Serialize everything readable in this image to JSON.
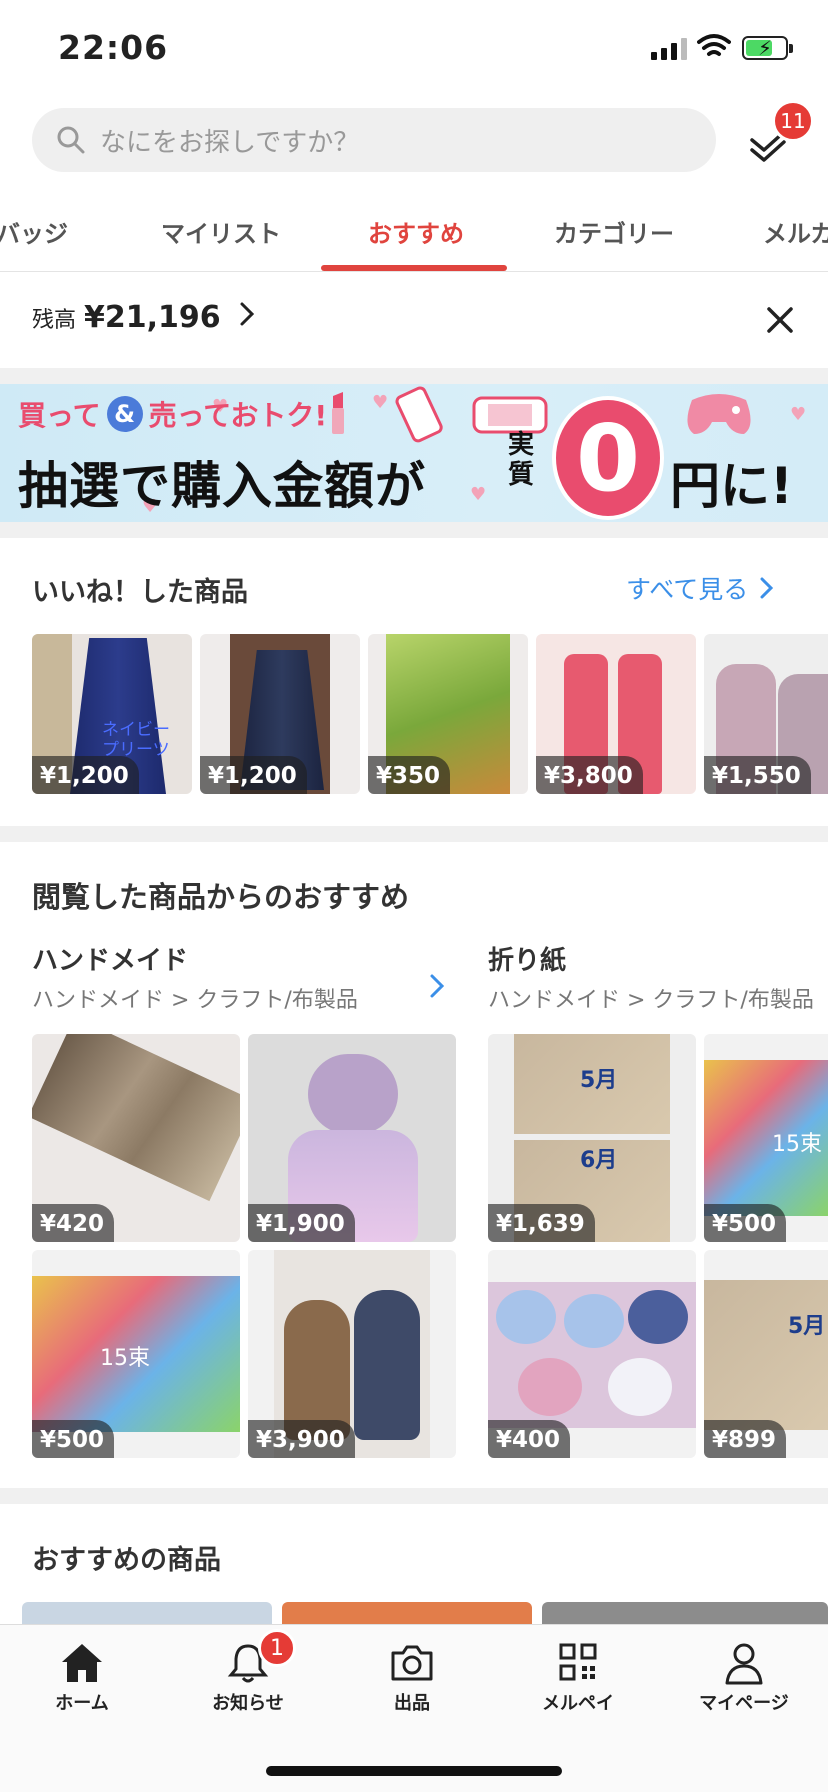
{
  "status_bar": {
    "time": "22:06"
  },
  "search": {
    "placeholder": "なにをお探しですか？"
  },
  "todo": {
    "badge": "11"
  },
  "tabs": [
    {
      "label": "バッジ"
    },
    {
      "label": "マイリスト"
    },
    {
      "label": "おすすめ",
      "active": true
    },
    {
      "label": "カテゴリー"
    },
    {
      "label": "メルカ"
    }
  ],
  "balance": {
    "label": "残高",
    "amount": "¥21,196"
  },
  "banner": {
    "line1_a": "買って",
    "line1_amp": "&",
    "line1_b": "売っておトク!",
    "line2": "抽選で購入金額が",
    "jitsu": "実質",
    "zero": "0",
    "yen": "円に!"
  },
  "liked": {
    "title": "いいね！した商品",
    "see_all": "すべて見る",
    "items": [
      {
        "price": "¥1,200"
      },
      {
        "price": "¥1,200"
      },
      {
        "price": "¥350"
      },
      {
        "price": "¥3,800"
      },
      {
        "price": "¥1,550"
      }
    ],
    "overlay_text": "ネイビー プリーツ"
  },
  "viewed": {
    "title": "閲覧した商品からのおすすめ",
    "groups": [
      {
        "title": "ハンドメイド",
        "crumb": "ハンドメイド > クラフト/布製品",
        "items": [
          {
            "price": "¥420"
          },
          {
            "price": "¥1,900"
          },
          {
            "price": "¥500"
          },
          {
            "price": "¥3,900"
          }
        ]
      },
      {
        "title": "折り紙",
        "crumb": "ハンドメイド > クラフト/布製品",
        "items": [
          {
            "price": "¥1,639"
          },
          {
            "price": "¥500"
          },
          {
            "price": "¥400"
          },
          {
            "price": "¥899"
          }
        ]
      }
    ],
    "img_text": {
      "may": "5月",
      "june": "6月",
      "bunch": "15束"
    }
  },
  "recommended": {
    "title": "おすすめの商品"
  },
  "nav": [
    {
      "label": "ホーム",
      "icon": "home-icon"
    },
    {
      "label": "お知らせ",
      "icon": "bell-icon",
      "badge": "1"
    },
    {
      "label": "出品",
      "icon": "camera-icon"
    },
    {
      "label": "メルペイ",
      "icon": "qr-icon"
    },
    {
      "label": "マイページ",
      "icon": "person-icon"
    }
  ]
}
